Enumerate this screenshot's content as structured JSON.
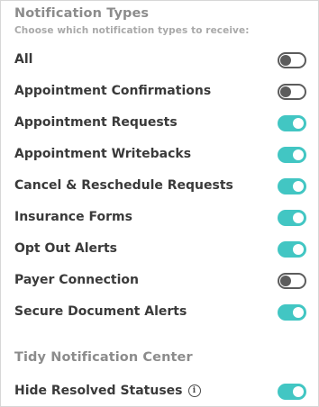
{
  "header": {
    "title": "Notification Types",
    "subtitle": "Choose which notification types to receive:"
  },
  "notification_types": [
    {
      "label": "All",
      "enabled": false
    },
    {
      "label": "Appointment Confirmations",
      "enabled": false
    },
    {
      "label": "Appointment Requests",
      "enabled": true
    },
    {
      "label": "Appointment Writebacks",
      "enabled": true
    },
    {
      "label": "Cancel & Reschedule Requests",
      "enabled": true
    },
    {
      "label": "Insurance Forms",
      "enabled": true
    },
    {
      "label": "Opt Out Alerts",
      "enabled": true
    },
    {
      "label": "Payer Connection",
      "enabled": false
    },
    {
      "label": "Secure Document Alerts",
      "enabled": true
    }
  ],
  "tidy": {
    "title": "Tidy Notification Center",
    "hide_resolved": {
      "label": "Hide Resolved Statuses",
      "info_icon": "info-circle-icon",
      "enabled": true
    }
  },
  "colors": {
    "toggle_on": "#42c6c3",
    "toggle_off": "#5c5c5c",
    "section_title": "#8c8c8c",
    "label_text": "#3a3a3a"
  }
}
